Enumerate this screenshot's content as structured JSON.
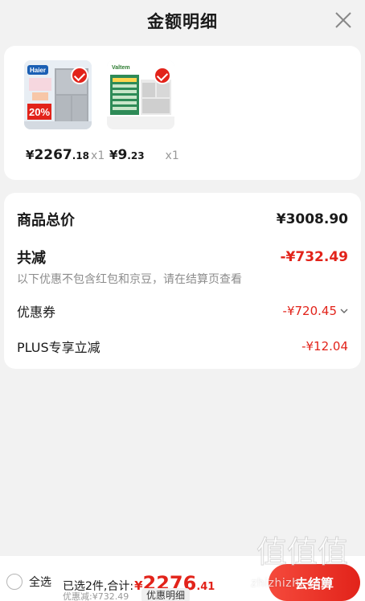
{
  "header": {
    "title": "金额明细"
  },
  "products": [
    {
      "yen": "¥",
      "price_int": "2267",
      "price_dec": ".18",
      "qty": "x1",
      "brand": "Haier",
      "badge": "20%"
    },
    {
      "yen": "¥",
      "price_int": "9",
      "price_dec": ".23",
      "qty": "x1",
      "brand": "Valtem"
    }
  ],
  "summary": {
    "total_label": "商品总价",
    "total_value": "¥3008.90",
    "reduce_label": "共减",
    "reduce_value": "-¥732.49",
    "note": "以下优惠不包含红包和京豆，请在结算页查看",
    "coupon_label": "优惠券",
    "coupon_value": "-¥720.45",
    "plus_label": "PLUS专享立减",
    "plus_value": "-¥12.04"
  },
  "footer": {
    "select_all": "全选",
    "selected_count": "已选2件,合计:",
    "total_symbol": "¥",
    "total_int": "2276",
    "total_dec": ".41",
    "discount_note": "优惠减:¥732.49",
    "detail_label": "优惠明细",
    "checkout_label": "去结算"
  },
  "watermark": {
    "logo": "值值值",
    "text": "zhizhizhi.com"
  },
  "colors": {
    "accent": "#e2231a",
    "muted": "#8c8c8c",
    "background": "#f2f2f2"
  }
}
